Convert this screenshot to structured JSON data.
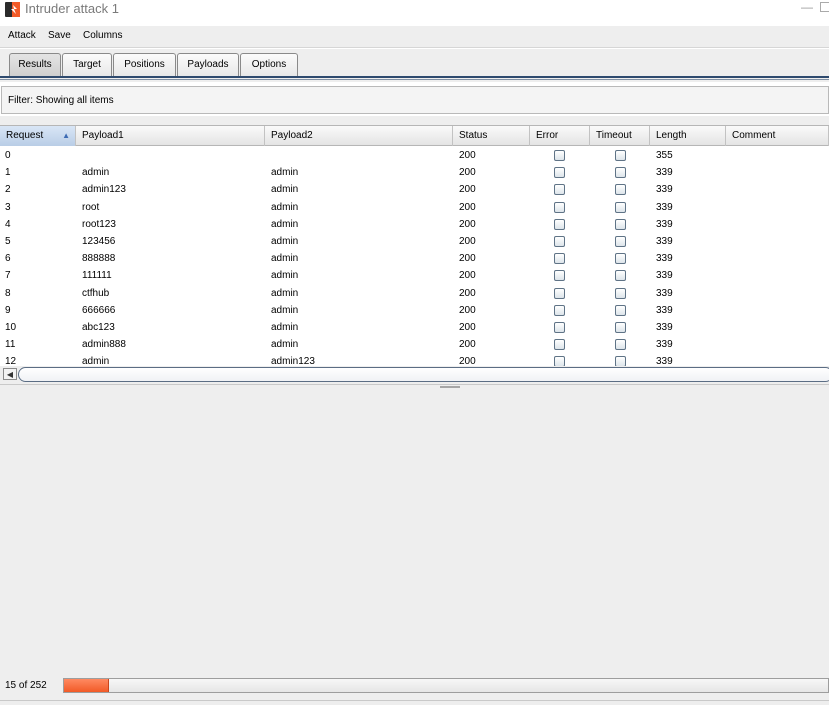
{
  "window": {
    "title": "Intruder attack 1",
    "minimize_glyph": "—",
    "app_icon": "burp-icon",
    "accent_color": "#f25a27"
  },
  "menu": [
    "Attack",
    "Save",
    "Columns"
  ],
  "tabs": [
    {
      "label": "Results",
      "active": true
    },
    {
      "label": "Target",
      "active": false
    },
    {
      "label": "Positions",
      "active": false
    },
    {
      "label": "Payloads",
      "active": false
    },
    {
      "label": "Options",
      "active": false
    }
  ],
  "filter": {
    "text": "Filter: Showing all items"
  },
  "table": {
    "columns": [
      "Request",
      "Payload1",
      "Payload2",
      "Status",
      "Error",
      "Timeout",
      "Length",
      "Comment"
    ],
    "sort_column": "Request",
    "sort_direction": "ascending",
    "rows": [
      {
        "request": "0",
        "payload1": "",
        "payload2": "",
        "status": "200",
        "error": false,
        "timeout": false,
        "length": "355",
        "comment": ""
      },
      {
        "request": "1",
        "payload1": "admin",
        "payload2": "admin",
        "status": "200",
        "error": false,
        "timeout": false,
        "length": "339",
        "comment": ""
      },
      {
        "request": "2",
        "payload1": "admin123",
        "payload2": "admin",
        "status": "200",
        "error": false,
        "timeout": false,
        "length": "339",
        "comment": ""
      },
      {
        "request": "3",
        "payload1": "root",
        "payload2": "admin",
        "status": "200",
        "error": false,
        "timeout": false,
        "length": "339",
        "comment": ""
      },
      {
        "request": "4",
        "payload1": "root123",
        "payload2": "admin",
        "status": "200",
        "error": false,
        "timeout": false,
        "length": "339",
        "comment": ""
      },
      {
        "request": "5",
        "payload1": "123456",
        "payload2": "admin",
        "status": "200",
        "error": false,
        "timeout": false,
        "length": "339",
        "comment": ""
      },
      {
        "request": "6",
        "payload1": "888888",
        "payload2": "admin",
        "status": "200",
        "error": false,
        "timeout": false,
        "length": "339",
        "comment": ""
      },
      {
        "request": "7",
        "payload1": "111111",
        "payload2": "admin",
        "status": "200",
        "error": false,
        "timeout": false,
        "length": "339",
        "comment": ""
      },
      {
        "request": "8",
        "payload1": "ctfhub",
        "payload2": "admin",
        "status": "200",
        "error": false,
        "timeout": false,
        "length": "339",
        "comment": ""
      },
      {
        "request": "9",
        "payload1": "666666",
        "payload2": "admin",
        "status": "200",
        "error": false,
        "timeout": false,
        "length": "339",
        "comment": ""
      },
      {
        "request": "10",
        "payload1": "abc123",
        "payload2": "admin",
        "status": "200",
        "error": false,
        "timeout": false,
        "length": "339",
        "comment": ""
      },
      {
        "request": "11",
        "payload1": "admin888",
        "payload2": "admin",
        "status": "200",
        "error": false,
        "timeout": false,
        "length": "339",
        "comment": ""
      },
      {
        "request": "12",
        "payload1": "admin",
        "payload2": "admin123",
        "status": "200",
        "error": false,
        "timeout": false,
        "length": "339",
        "comment": ""
      }
    ]
  },
  "status": {
    "progress_text": "15 of 252",
    "completed": 15,
    "total": 252
  }
}
